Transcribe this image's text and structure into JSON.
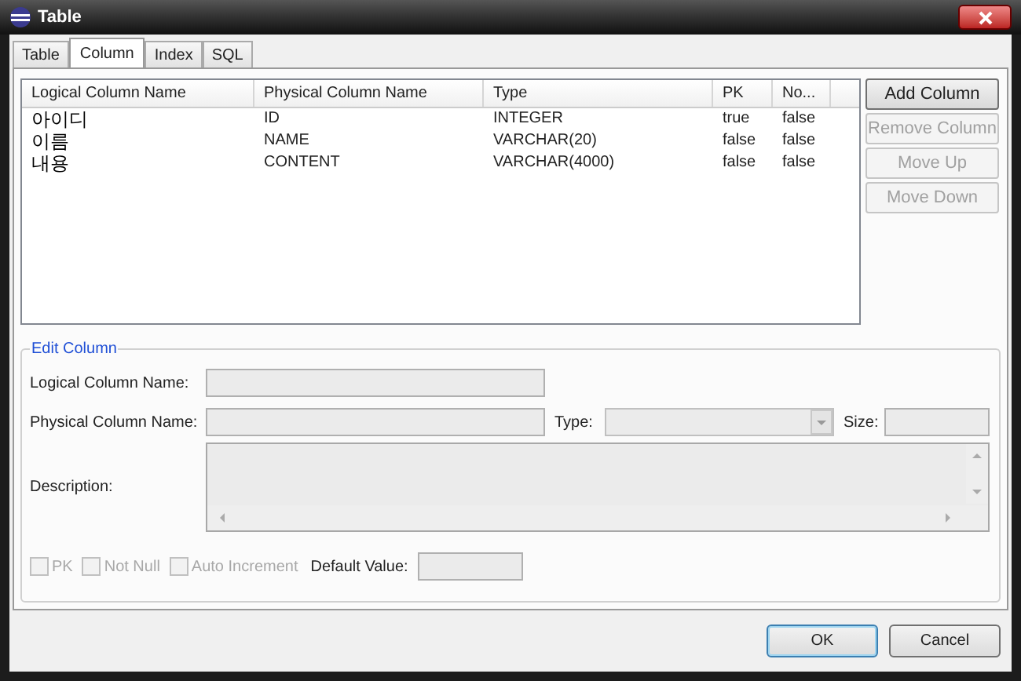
{
  "window": {
    "title": "Table"
  },
  "tabs": [
    {
      "label": "Table",
      "selected": false
    },
    {
      "label": "Column",
      "selected": true
    },
    {
      "label": "Index",
      "selected": false
    },
    {
      "label": "SQL",
      "selected": false
    }
  ],
  "table": {
    "columns": [
      "Logical Column Name",
      "Physical Column Name",
      "Type",
      "PK",
      "No..."
    ],
    "rows": [
      [
        "아이디",
        "ID",
        "INTEGER",
        "true",
        "false"
      ],
      [
        "이름",
        "NAME",
        "VARCHAR(20)",
        "false",
        "false"
      ],
      [
        "내용",
        "CONTENT",
        "VARCHAR(4000)",
        "false",
        "false"
      ]
    ]
  },
  "side_buttons": [
    {
      "label": "Add Column",
      "disabled": false
    },
    {
      "label": "Remove Column",
      "disabled": true
    },
    {
      "label": "Move Up",
      "disabled": true
    },
    {
      "label": "Move Down",
      "disabled": true
    }
  ],
  "edit_column": {
    "title": "Edit Column",
    "logical_label": "Logical Column Name:",
    "physical_label": "Physical Column Name:",
    "type_label": "Type:",
    "size_label": "Size:",
    "description_label": "Description:",
    "checkboxes": [
      {
        "label": "PK",
        "checked": false,
        "disabled": true
      },
      {
        "label": "Not Null",
        "checked": false,
        "disabled": true
      },
      {
        "label": "Auto Increment",
        "checked": false,
        "disabled": true
      }
    ],
    "default_label": "Default Value:"
  },
  "buttons": [
    {
      "label": "OK",
      "default": true
    },
    {
      "label": "Cancel",
      "default": false
    }
  ]
}
